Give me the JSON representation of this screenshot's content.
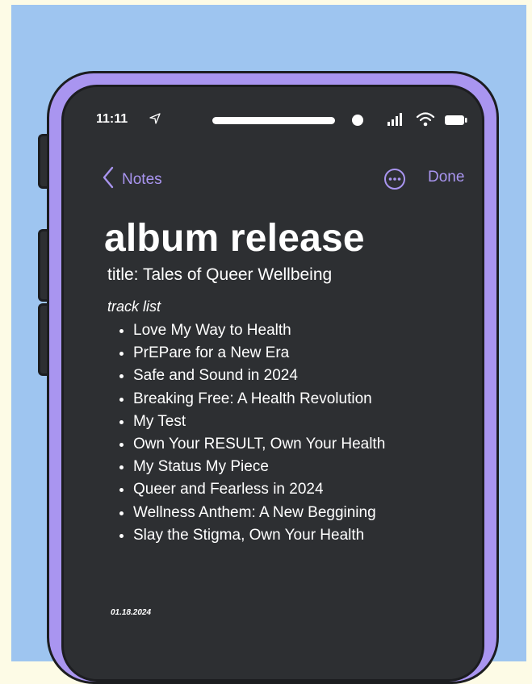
{
  "status_bar": {
    "time": "11:11",
    "location_icon": "location-arrow-icon",
    "signal_icon": "cellular-signal-icon",
    "wifi_icon": "wifi-icon",
    "battery_icon": "battery-icon"
  },
  "nav": {
    "back_label": "Notes",
    "more_icon": "ellipsis-circle-icon",
    "done_label": "Done"
  },
  "note": {
    "title": "album release",
    "subtitle": "title: Tales of Queer Wellbeing",
    "section_label": "track list",
    "tracks": [
      "Love My Way to Health",
      "PrEPare for a New Era",
      "Safe and Sound in 2024",
      "Breaking Free: A Health Revolution",
      "My Test",
      "Own Your RESULT, Own Your Health",
      "My Status My Piece",
      "Queer and Fearless in 2024",
      "Wellness Anthem: A New Beggining",
      "Slay the Stigma, Own Your Health"
    ],
    "date": "01.18.2024"
  },
  "colors": {
    "background_outer": "#fdfbe6",
    "background_panel": "#9ec5f0",
    "phone_frame": "#a995f0",
    "screen": "#2d2f32",
    "accent": "#a995f0",
    "text": "#ffffff"
  }
}
